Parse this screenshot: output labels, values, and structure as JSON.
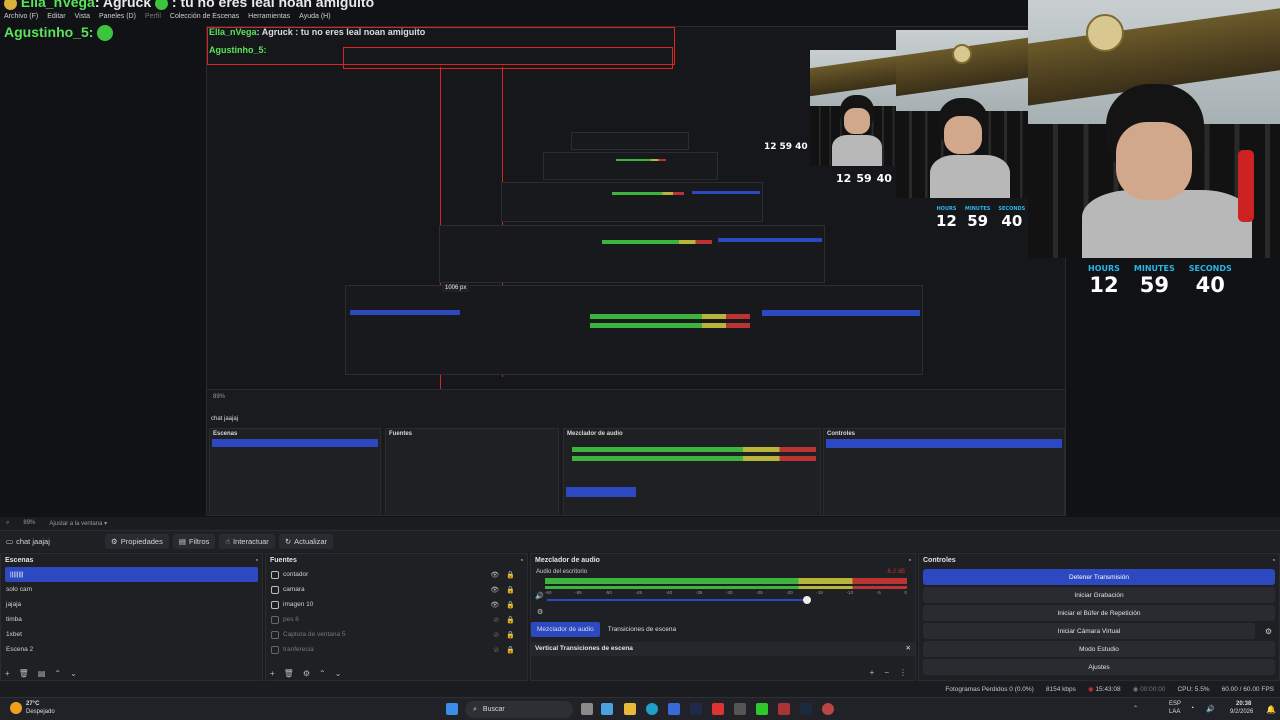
{
  "chat": {
    "line1_user": "Ella_nVega",
    "line1_user2": "Agruck",
    "line1_msg": ": tu no eres leal noan amiguito",
    "line2_user": "Agustinho_5:"
  },
  "menu": [
    "Archivo (F)",
    "Editar",
    "Vista",
    "Paneles (D)",
    "Perfil",
    "Colección de Escenas",
    "Herramientas",
    "Ayuda (H)"
  ],
  "nested": {
    "px_label": "1006 px",
    "scene_name": "chat jaajaj",
    "panel_heads": [
      "Escenas",
      "Fuentes",
      "Mezclador de audio",
      "Controles"
    ]
  },
  "timer": {
    "labels": [
      "HOURS",
      "MINUTES",
      "SECONDS"
    ],
    "values": [
      "12",
      "59",
      "40"
    ]
  },
  "zoombar": {
    "zoom": "89%",
    "fit": "Ajustar a la ventana"
  },
  "toolbar": {
    "scene": "chat jaajaj",
    "properties": "Propiedades",
    "filters": "Filtros",
    "interact": "Interactuar",
    "refresh": "Actualizar"
  },
  "scenes": {
    "title": "Escenas",
    "items": [
      "||||||||",
      "solo cam",
      "jajaja",
      "timba",
      "1xbet",
      "Escena 2"
    ]
  },
  "sources": {
    "title": "Fuentes",
    "items": [
      "contador",
      "camara",
      "imagen 10",
      "pes 6",
      "Captura de ventana 5",
      "tranferecia"
    ]
  },
  "mixer": {
    "title": "Mezclador de audio",
    "channel": "Audio del escritorio",
    "db": "-6.2 dB",
    "ticks": [
      "-60",
      "-55",
      "-50",
      "-45",
      "-40",
      "-35",
      "-30",
      "-25",
      "-20",
      "-15",
      "-10",
      "-5",
      "0"
    ],
    "tab_mixer": "Mezclador de audio",
    "tab_transitions": "Transiciones de escena",
    "vertical_title": "Vertical Transiciones de escena"
  },
  "controls": {
    "title": "Controles",
    "buttons": [
      "Detener Transmisión",
      "Iniciar Grabación",
      "Iniciar el Búfer de Repetición",
      "Iniciar Cámara Virtual",
      "Modo Estudio",
      "Ajustes"
    ]
  },
  "status": {
    "dropped": "Fotogramas Perdidos 0 (0.0%)",
    "bitrate": "8154 kbps",
    "live": "15:43:08",
    "rec": "00:00:00",
    "cpu": "CPU: 5.5%",
    "fps": "60.00 / 60.00 FPS"
  },
  "taskbar": {
    "weather_temp": "27°C",
    "weather_desc": "Despejado",
    "search": "Buscar",
    "lang1": "ESP",
    "lang2": "LAA",
    "time": "20:38",
    "date": "9/2/2026"
  },
  "colors": {
    "accent": "#2c49c2",
    "chat_user": "#5be35b",
    "timer_label": "#29b6e8",
    "recording_frame": "#dd2222"
  }
}
